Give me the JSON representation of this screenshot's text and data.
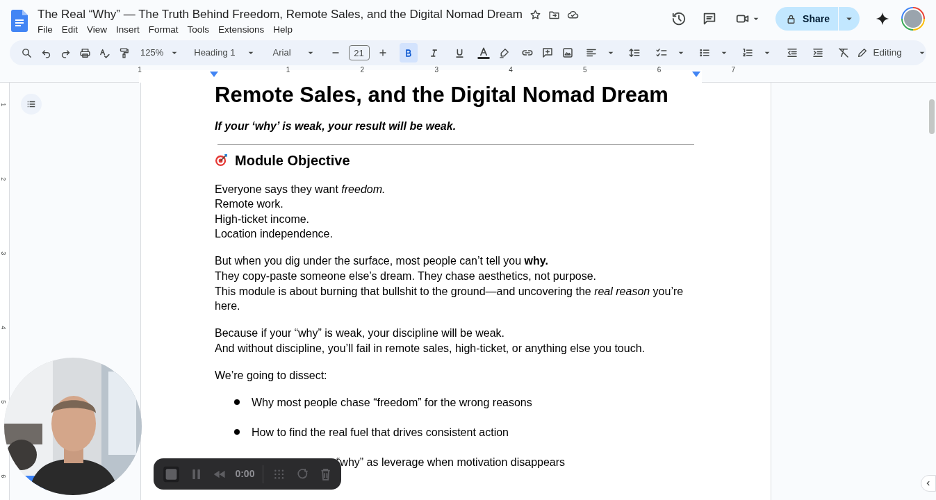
{
  "document_title": "The Real “Why” — The Truth Behind Freedom, Remote Sales, and the Digital Nomad Dream",
  "menu": [
    "File",
    "Edit",
    "View",
    "Insert",
    "Format",
    "Tools",
    "Extensions",
    "Help"
  ],
  "share": {
    "label": "Share"
  },
  "toolbar": {
    "zoom": "125%",
    "style": "Heading 1",
    "font": "Arial",
    "font_size": "21",
    "format_buttons": [
      {
        "kind": "bold",
        "selected": true
      },
      {
        "kind": "italic",
        "selected": false
      },
      {
        "kind": "underline",
        "selected": false
      }
    ],
    "mode": "Editing"
  },
  "ruler": [
    "1",
    "1",
    "2",
    "3",
    "4",
    "5",
    "6",
    "7"
  ],
  "vertical_ruler": [
    "1",
    "2",
    "3",
    "4",
    "5",
    "6"
  ],
  "document": {
    "heading": "Remote Sales, and the Digital Nomad Dream",
    "subtitle": "If your ‘why’ is weak, your result will be weak.",
    "section_title": "Module Objective",
    "paragraphs": [
      [
        "Everyone says they want *freedom.*",
        "Remote work.",
        "High-ticket income.",
        "Location independence."
      ],
      [
        "But when you dig under the surface, most people can’t tell you **why.**",
        "They copy-paste someone else’s dream. They chase aesthetics, not purpose.",
        "This module is about burning that bullshit to the ground—and uncovering the *real reason* you’re here."
      ],
      [
        "Because if your “why” is weak, your discipline will be weak.",
        "And without discipline, you’ll fail in remote sales, high-ticket, or anything else you touch."
      ],
      [
        "We’re going to dissect:"
      ]
    ],
    "bullets": [
      {
        "text": "Why most people chase “freedom” for the wrong reasons",
        "kind": "full"
      },
      {
        "text": "How to find the real fuel that drives consistent action",
        "kind": "full"
      },
      {
        "text": "“why” as leverage when motivation disappears",
        "kind": "covered"
      }
    ]
  },
  "recorder": {
    "time": "0:00"
  }
}
